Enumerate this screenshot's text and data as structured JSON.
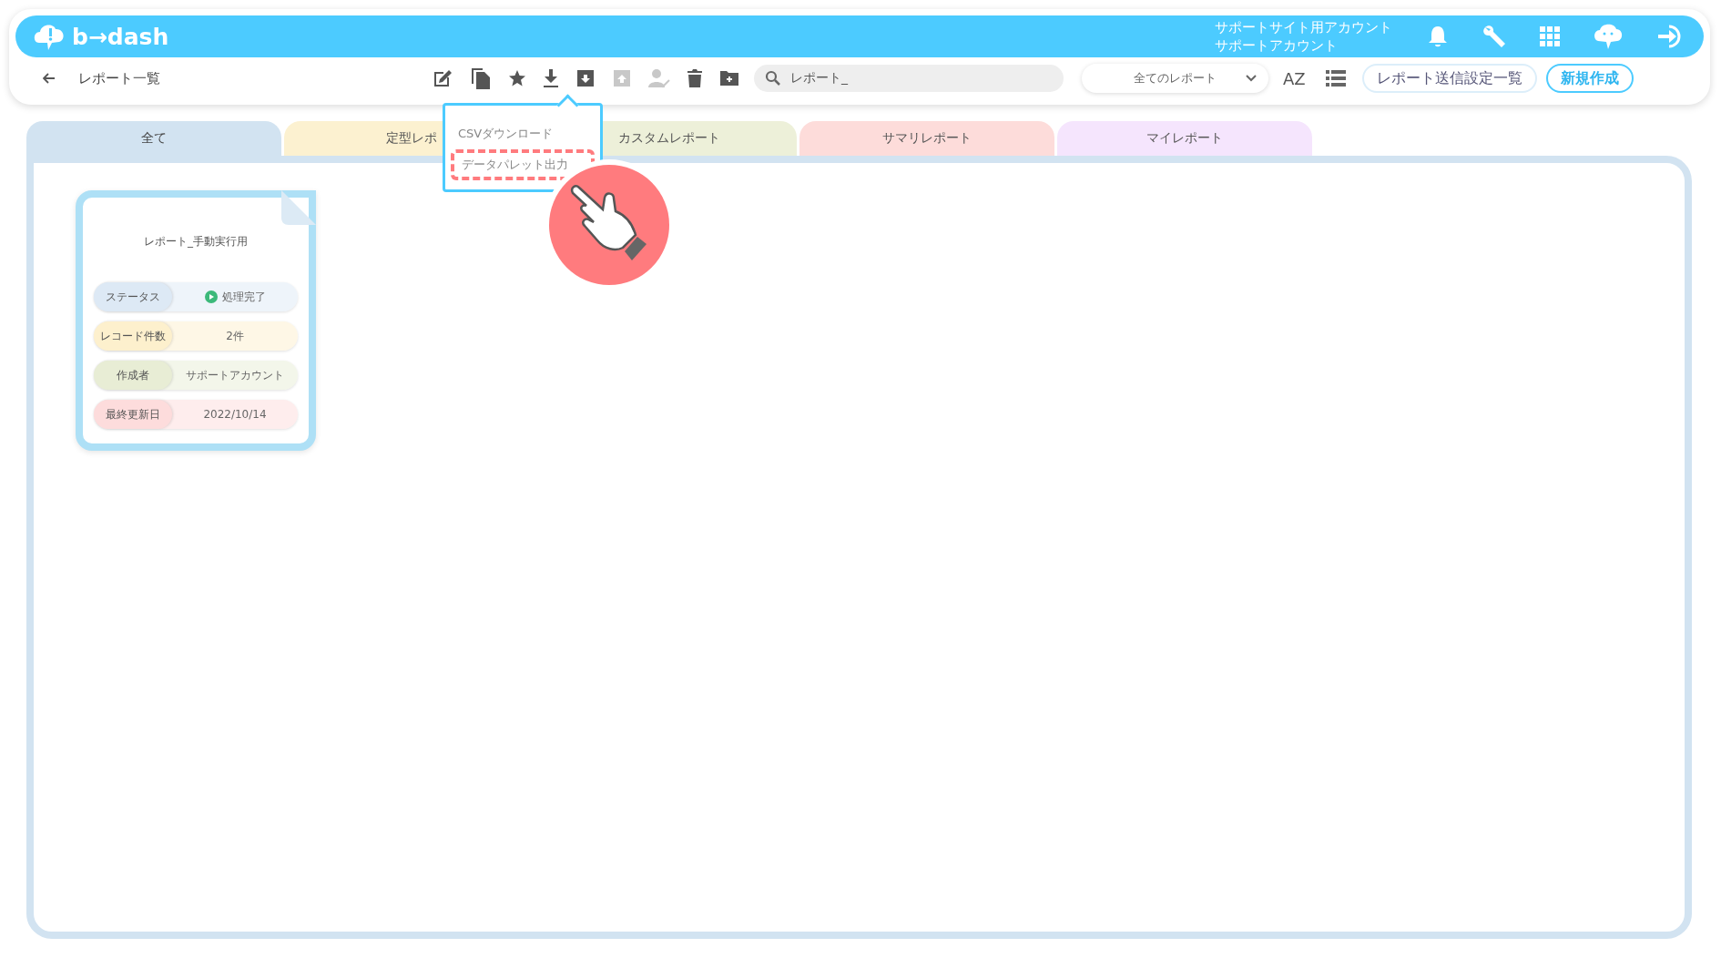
{
  "header": {
    "logo": "b→dash",
    "account_lines": [
      "サポートサイト用アカウント",
      "サポートアカウント"
    ],
    "icons": [
      {
        "kind": "bell"
      },
      {
        "kind": "wrench"
      },
      {
        "kind": "grid"
      },
      {
        "kind": "mascot"
      },
      {
        "kind": "logout"
      }
    ]
  },
  "toolbar": {
    "page_title": "レポート一覧",
    "icons": [
      {
        "kind": "edit",
        "disabled": false
      },
      {
        "kind": "copy",
        "disabled": false
      },
      {
        "kind": "star",
        "disabled": false
      },
      {
        "kind": "download",
        "disabled": false
      },
      {
        "kind": "box-down",
        "disabled": false
      },
      {
        "kind": "box-up",
        "disabled": true
      },
      {
        "kind": "user-check",
        "disabled": true
      },
      {
        "kind": "trash",
        "disabled": false
      },
      {
        "kind": "folder-plus",
        "disabled": false
      }
    ],
    "search": {
      "value": "レポート_"
    },
    "filter": {
      "value": "全てのレポート"
    },
    "sort_label": "AZ",
    "buttons": [
      {
        "label": "レポート送信設定一覧",
        "primary": false
      },
      {
        "label": "新規作成",
        "primary": true
      }
    ]
  },
  "download_menu": [
    {
      "label": "CSVダウンロード",
      "highlighted": false
    },
    {
      "label": "データパレット出力",
      "highlighted": true
    }
  ],
  "tabs": [
    {
      "label": "全て",
      "selected": true
    },
    {
      "label": "定型レポ",
      "selected": false,
      "color": "#fcf1d0"
    },
    {
      "label": "カスタムレポート",
      "selected": false,
      "color": "#edf0d9"
    },
    {
      "label": "サマリレポート",
      "selected": false,
      "color": "#fddcda"
    },
    {
      "label": "マイレポート",
      "selected": false,
      "color": "#f5e5fd"
    }
  ],
  "reports": [
    {
      "title": "レポート_手動実行用",
      "fields": [
        {
          "kind": "status",
          "label": "ステータス",
          "value": "処理完了",
          "color": "#dde9f5"
        },
        {
          "kind": "text",
          "label": "レコード件数",
          "value": "2件",
          "color": "#fdf0cd"
        },
        {
          "kind": "text",
          "label": "作成者",
          "value": "サポートアカウント",
          "color": "#e8edd5"
        },
        {
          "kind": "text",
          "label": "最終更新日",
          "value": "2022/10/14",
          "color": "#fddcdc"
        }
      ]
    }
  ]
}
